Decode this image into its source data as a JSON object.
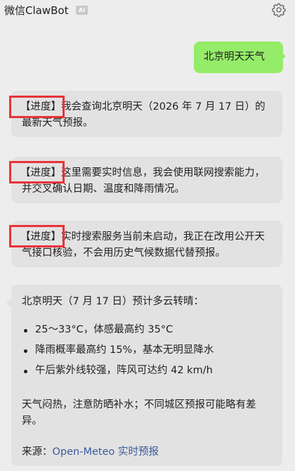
{
  "header": {
    "title": "微信ClawBot",
    "ai_badge": "AI",
    "settings_icon": "gear-icon"
  },
  "messages": {
    "user_query": "北京明天天气",
    "progress": [
      {
        "tag": "【进度】",
        "text": "我会查询北京明天（2026 年 7 月 17 日）的最新天气预报。"
      },
      {
        "tag": "【进度】",
        "text": "这里需要实时信息，我会使用联网搜索能力，并交叉确认日期、温度和降雨情况。"
      },
      {
        "tag": "【进度】",
        "text": "实时搜索服务当前未启动，我正在改用公开天气接口核验，不会用历史气候数据代替预报。"
      }
    ],
    "reply": {
      "headline": "北京明天（7 月 17 日）预计多云转晴：",
      "bullets": [
        "25～33°C，体感最高约 35°C",
        "降雨概率最高约 15%，基本无明显降水",
        "午后紫外线较强，阵风可达约 42 km/h"
      ],
      "note": "天气闷热，注意防晒补水；不同城区预报可能略有差异。",
      "source_label": "来源：",
      "source_link": "Open-Meteo 实时预报"
    }
  },
  "colors": {
    "background": "#ededed",
    "user_bubble": "#95ec69",
    "bot_bubble": "#e2e2e2",
    "highlight_box": "#e8333a",
    "link": "#3b5b9c"
  }
}
